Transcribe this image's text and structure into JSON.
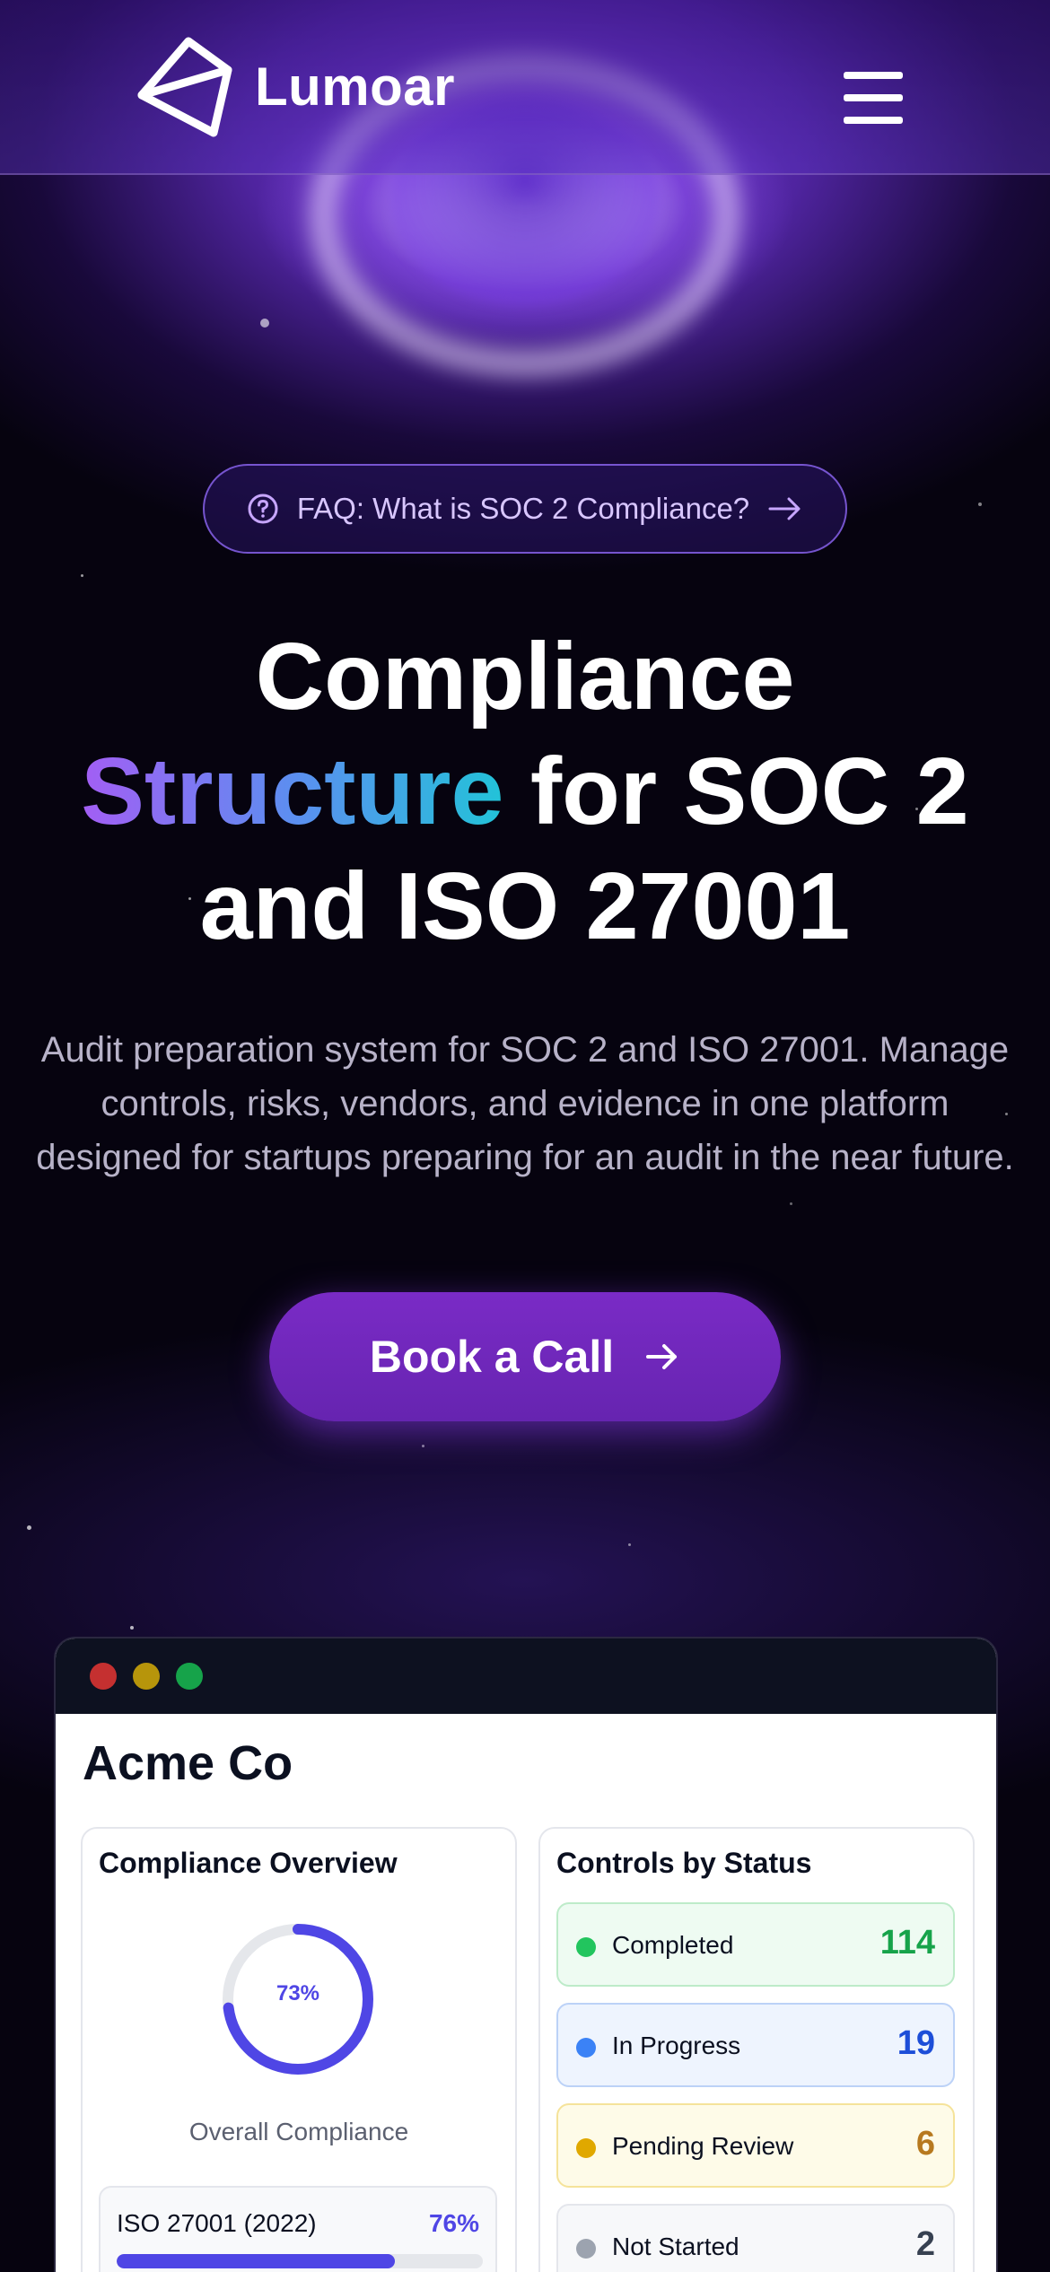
{
  "brand": {
    "name": "Lumoar"
  },
  "header": {
    "menu_icon": "hamburger-menu-icon"
  },
  "faq": {
    "icon": "question-circle-icon",
    "label": "FAQ: What is SOC 2 Compliance?",
    "arrow_icon": "arrow-right-icon"
  },
  "hero": {
    "headline_part1": "Compliance",
    "headline_highlight": "Structure",
    "headline_part2": " for SOC 2",
    "headline_part3": "and ISO 27001",
    "subtitle": "Audit preparation system for SOC 2 and ISO 27001. Manage controls, risks, vendors, and evidence in one platform designed for startups preparing for an audit in the near future.",
    "cta_label": "Book a Call",
    "cta_icon": "arrow-right-icon"
  },
  "dashboard": {
    "company": "Acme Co",
    "window_dots": [
      "#c53030",
      "#b7950b",
      "#16a34a"
    ],
    "overview": {
      "title": "Compliance Overview",
      "overall_percent_label": "73%",
      "overall_value": 0.73,
      "overall_label": "Overall Compliance",
      "frameworks": [
        {
          "name": "ISO 27001 (2022)",
          "percent_label": "76%",
          "value": 0.76
        }
      ]
    },
    "controls": {
      "title": "Controls by Status",
      "items": [
        {
          "label": "Completed",
          "count": "114",
          "color": "#16a34a",
          "bg": "#eefbf2",
          "border": "#bdebc9"
        },
        {
          "label": "In Progress",
          "count": "19",
          "color": "#1d4ed8",
          "bg": "#eef4fe",
          "border": "#bcd2f7",
          "dot": "#3b82f6"
        },
        {
          "label": "Pending Review",
          "count": "6",
          "color": "#b7791f",
          "bg": "#fefbe8",
          "border": "#f5e39a",
          "dot": "#e0a800"
        },
        {
          "label": "Not Started",
          "count": "2",
          "color": "#374151",
          "bg": "#f7f8fa",
          "border": "#e4e6ec",
          "dot": "#9ca3af"
        }
      ]
    }
  }
}
